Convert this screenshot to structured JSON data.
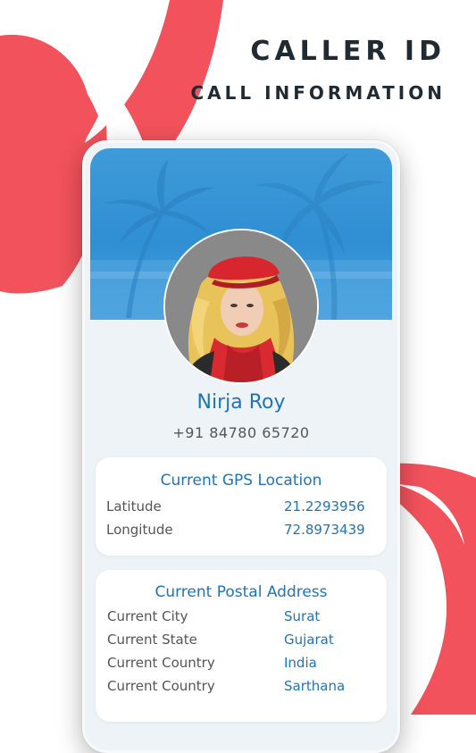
{
  "header": {
    "title": "CALLER ID",
    "subtitle": "CALL INFORMATION"
  },
  "contact": {
    "name": "Nirja Roy",
    "phone": "+91 84780 65720"
  },
  "gps_card": {
    "title": "Current GPS Location",
    "rows": [
      {
        "label": "Latitude",
        "value": "21.2293956"
      },
      {
        "label": "Longitude",
        "value": "72.8973439"
      }
    ]
  },
  "postal_card": {
    "title": "Current Postal Address",
    "rows": [
      {
        "label": "Current City",
        "value": "Surat"
      },
      {
        "label": "Current State",
        "value": "Gujarat"
      },
      {
        "label": "Current Country",
        "value": "India"
      },
      {
        "label": "Current Country",
        "value": "Sarthana"
      }
    ]
  },
  "colors": {
    "accent_red": "#f2525b",
    "banner_blue": "#3a95d6",
    "link_blue": "#1f74b8",
    "title_dark": "#1f2a33"
  },
  "icons": [
    "palm-tree-banner-art",
    "profile-photo"
  ]
}
